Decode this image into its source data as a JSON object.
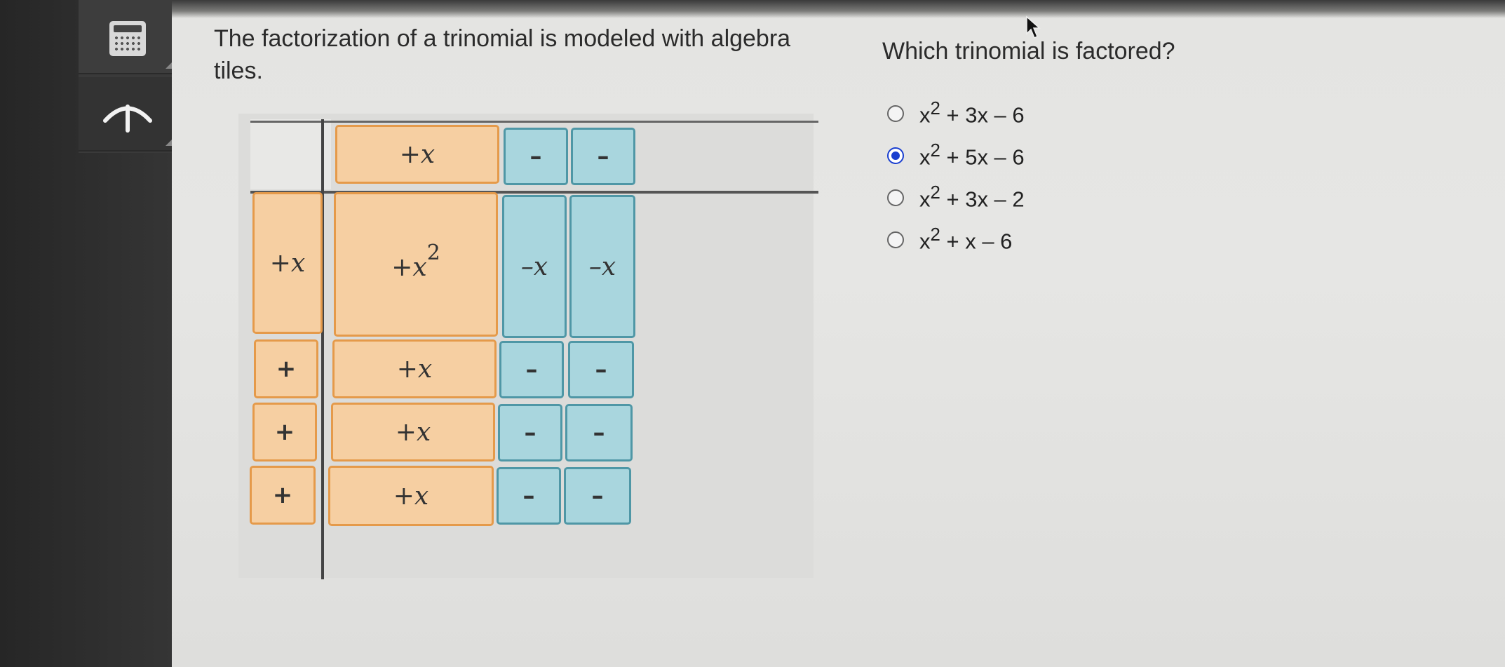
{
  "question": {
    "stem": "The factorization of a trinomial is modeled with algebra tiles.",
    "prompt": "Which trinomial is factored?"
  },
  "options": [
    {
      "text": "x2 + 3x – 6",
      "base": "x",
      "exp": "2",
      "rest": " + 3x – 6",
      "selected": false
    },
    {
      "text": "x2 + 5x – 6",
      "base": "x",
      "exp": "2",
      "rest": " + 5x – 6",
      "selected": true
    },
    {
      "text": "x2 + 3x – 2",
      "base": "x",
      "exp": "2",
      "rest": " + 3x – 2",
      "selected": false
    },
    {
      "text": "x2 + x – 6",
      "base": "x",
      "exp": "2",
      "rest": " + x – 6",
      "selected": false
    }
  ],
  "tiles": {
    "top_row": [
      "+x",
      "–",
      "–"
    ],
    "left_col": [
      "+x",
      "+",
      "+",
      "+"
    ],
    "x2_label": "+x",
    "x2_exp": "2",
    "neg_x": "–x",
    "pos_x": "+x",
    "neg_unit": "–"
  },
  "toolbar": {
    "calculator_icon": "calculator-icon",
    "up_icon": "arrow-up-icon"
  },
  "colors": {
    "orange_tile": "#f6cfa2",
    "blue_tile": "#a9d6de",
    "selected_radio": "#1a3fd0"
  }
}
